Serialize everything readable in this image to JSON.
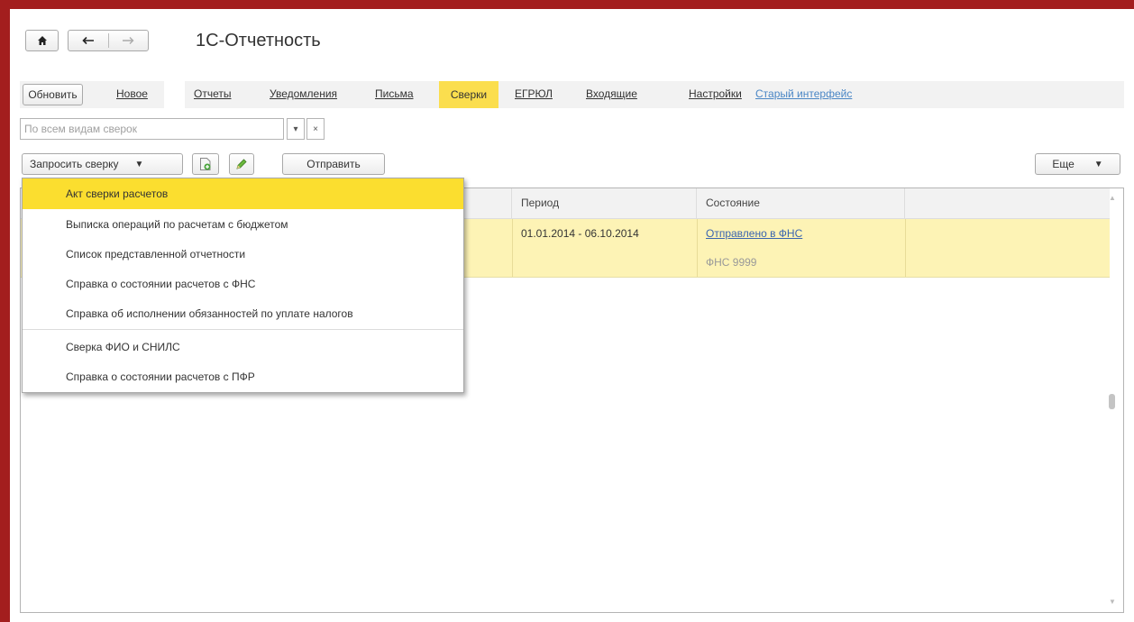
{
  "app": {
    "title": "1С-Отчетность"
  },
  "nav": {
    "back_icon": "arrow-left-icon",
    "forward_icon": "arrow-right-icon",
    "home_icon": "home-icon"
  },
  "toolbar": {
    "refresh_label": "Обновить",
    "new_label": "Новое"
  },
  "tabs": [
    {
      "label": "Отчеты",
      "active": false
    },
    {
      "label": "Уведомления",
      "active": false
    },
    {
      "label": "Письма",
      "active": false
    },
    {
      "label": "Сверки",
      "active": true
    },
    {
      "label": "ЕГРЮЛ",
      "active": false
    },
    {
      "label": "Входящие",
      "active": false
    },
    {
      "label": "Настройки",
      "active": false
    }
  ],
  "old_interface_label": "Старый интерфейс",
  "filter": {
    "placeholder": "По всем видам сверок",
    "dropdown_glyph": "▾",
    "clear_glyph": "×"
  },
  "actions": {
    "request_label": "Запросить сверку",
    "request_arrow": "▼",
    "send_label": "Отправить",
    "more_label": "Еще",
    "more_arrow": "▼"
  },
  "table": {
    "columns": [
      "Период",
      "Состояние"
    ],
    "rows": [
      {
        "period": "01.01.2014 - 06.10.2014",
        "status": "Отправлено в ФНС",
        "recipient": "ФНС 9999"
      }
    ]
  },
  "dropdown_menu": {
    "items": [
      "Акт сверки расчетов",
      "Выписка операций по расчетам с бюджетом",
      "Список представленной отчетности",
      "Справка о состоянии расчетов с ФНС",
      "Справка об исполнении обязанностей по уплате налогов",
      "Сверка ФИО и СНИЛС",
      "Справка о состоянии расчетов с ПФР"
    ],
    "highlighted_index": 0
  },
  "colors": {
    "frame": "#a31e1e",
    "active_tab": "#fbde4e",
    "row_highlight": "#fdf3b5",
    "link": "#3a65b0"
  }
}
